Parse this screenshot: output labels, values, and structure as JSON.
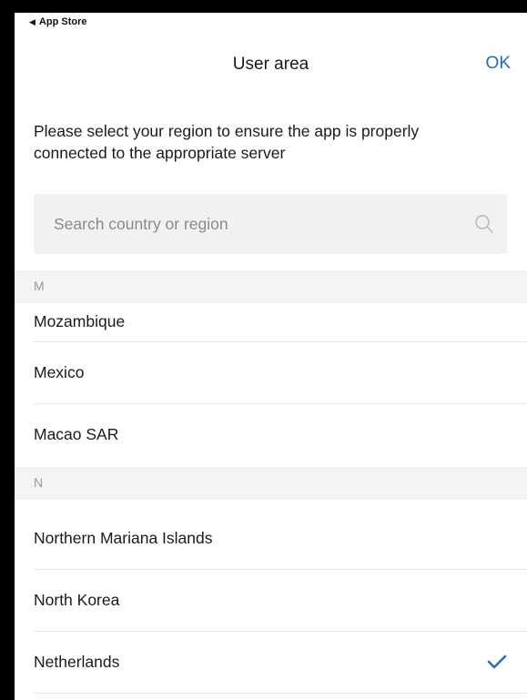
{
  "status_bar": {
    "back_arrow": "◀",
    "back_label": "App Store"
  },
  "nav": {
    "title": "User area",
    "ok_label": "OK"
  },
  "intro_text": "Please select your region to ensure the app is properly connected to the appropriate server",
  "search": {
    "placeholder": "Search country or region",
    "value": ""
  },
  "sections": [
    {
      "letter": "M",
      "items": [
        {
          "label": "Mozambique",
          "selected": false
        },
        {
          "label": "Mexico",
          "selected": false
        },
        {
          "label": "Macao SAR",
          "selected": false
        }
      ]
    },
    {
      "letter": "N",
      "items": [
        {
          "label": "Northern Mariana Islands",
          "selected": false
        },
        {
          "label": "North Korea",
          "selected": false
        },
        {
          "label": "Netherlands",
          "selected": true
        }
      ]
    }
  ],
  "colors": {
    "accent": "#2b6cb7",
    "section_bg": "#f4f4f4",
    "search_bg": "#f1f1f1"
  }
}
